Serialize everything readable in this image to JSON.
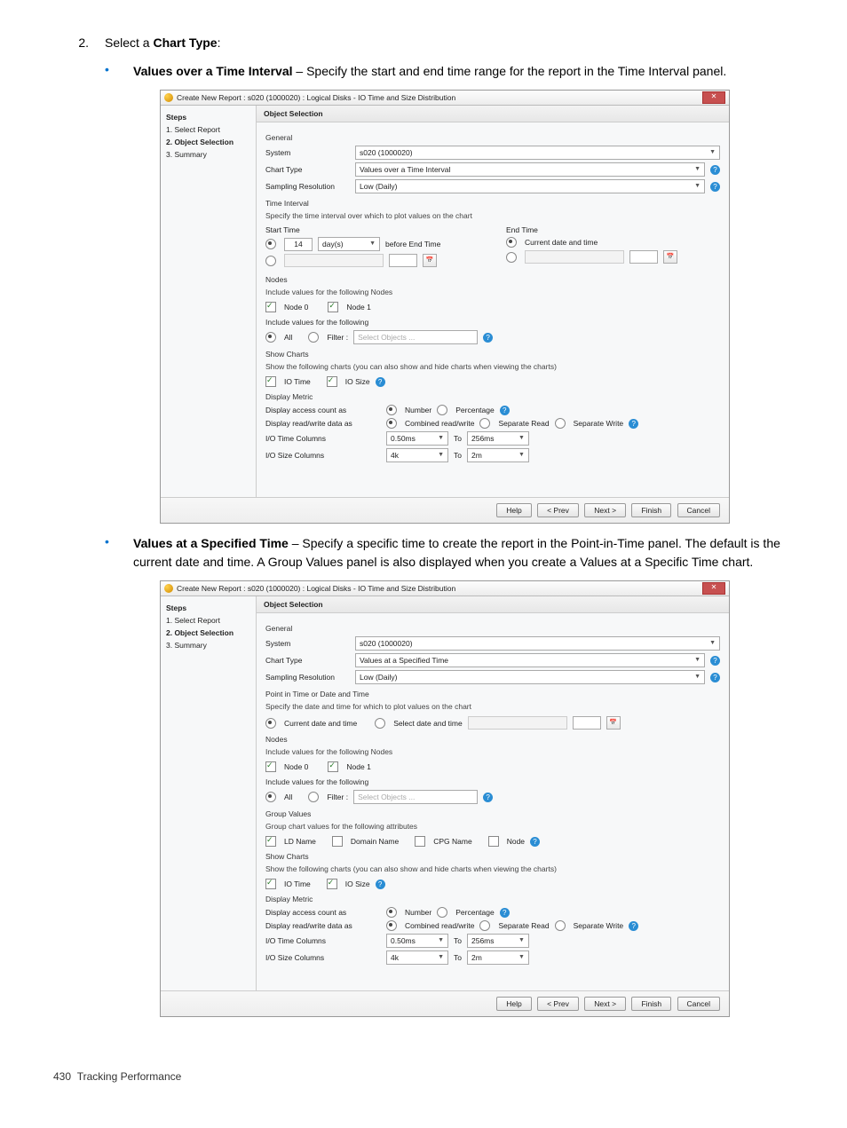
{
  "page": {
    "step_number": "2.",
    "step_text_prefix": "Select a ",
    "step_text_bold": "Chart Type",
    "step_text_suffix": ":",
    "footer_page": "430",
    "footer_title": "Tracking Performance"
  },
  "bullet1": {
    "title": "Values over a Time Interval",
    "desc": " – Specify the start and end time range for the report in the Time Interval panel."
  },
  "bullet2": {
    "title": "Values at a Specified Time",
    "desc": " – Specify a specific time to create the report in the Point-in-Time panel. The default is the current date and time. A Group Values panel is also displayed when you create a Values at a Specific Time chart."
  },
  "dlg": {
    "title": "Create New Report : s020 (1000020) : Logical Disks - IO Time and Size Distribution",
    "close": "✕",
    "steps_head": "Steps",
    "step1": "1. Select Report",
    "step2": "2. Object Selection",
    "step3": "3. Summary",
    "head": "Object Selection",
    "general": "General",
    "system_lbl": "System",
    "system_val": "s020 (1000020)",
    "charttype_lbl": "Chart Type",
    "sampling_lbl": "Sampling Resolution",
    "sampling_val": "Low (Daily)",
    "nodes_title": "Nodes",
    "nodes_sub": "Include values for the following Nodes",
    "node0": "Node 0",
    "node1": "Node 1",
    "include_title": "Include values for the following",
    "all": "All",
    "filter": "Filter :",
    "select_objects": "Select Objects ...",
    "show_title": "Show Charts",
    "show_sub": "Show the following charts (you can also show and hide charts when viewing the charts)",
    "io_time": "IO Time",
    "io_size": "IO Size",
    "metric_title": "Display Metric",
    "access_lbl": "Display access count as",
    "number": "Number",
    "percentage": "Percentage",
    "rw_lbl": "Display read/write data as",
    "combined": "Combined read/write",
    "sep_read": "Separate Read",
    "sep_write": "Separate Write",
    "time_cols_lbl": "I/O Time Columns",
    "time_from": "0.50ms",
    "to": "To",
    "time_to": "256ms",
    "size_cols_lbl": "I/O Size Columns",
    "size_from": "4k",
    "size_to": "2m",
    "btn_help": "Help",
    "btn_prev": "< Prev",
    "btn_next": "Next >",
    "btn_finish": "Finish",
    "btn_cancel": "Cancel"
  },
  "d1": {
    "charttype_val": "Values over a Time Interval",
    "interval_title": "Time Interval",
    "interval_sub": "Specify the time interval over which to plot values on the chart",
    "start_lbl": "Start Time",
    "end_lbl": "End Time",
    "days_val": "14",
    "days_unit": "day(s)",
    "before": "before End Time",
    "current": "Current date and time"
  },
  "d2": {
    "charttype_val": "Values at a Specified Time",
    "pit_title": "Point in Time or Date and Time",
    "pit_sub": "Specify the date and time for which to plot values on the chart",
    "current": "Current date and time",
    "select_dt": "Select date and time",
    "group_title": "Group Values",
    "group_sub": "Group chart values for the following attributes",
    "ld": "LD Name",
    "domain": "Domain Name",
    "cpg": "CPG Name",
    "node": "Node"
  }
}
